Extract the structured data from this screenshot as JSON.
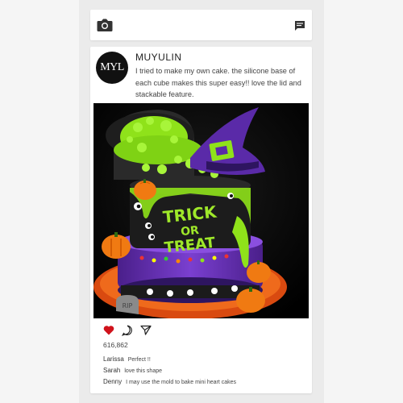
{
  "header": {
    "left_icon": "camera-icon",
    "right_icon": "message-icon"
  },
  "post": {
    "avatar_text": "MYL",
    "username": "MUYULIN",
    "caption": "I tried to make my own cake. the silicone base of each cube makes this super easy!! love the lid and stackable feature.",
    "image": {
      "cake_text_line1": "TRICK",
      "cake_text_line2": "OR",
      "cake_text_line3": "TREAT",
      "tombstone_text": "RIP"
    },
    "actions": {
      "like_icon": "heart-icon",
      "comment_icon": "comment-icon",
      "share_icon": "share-icon"
    },
    "likes": "616,862",
    "comments": [
      {
        "user": "Larissa",
        "text": "Perfect !!"
      },
      {
        "user": "Sarah",
        "text": "love this shape"
      },
      {
        "user": "Denny",
        "text": "I may use the mold to bake mini heart cakes"
      }
    ]
  },
  "colors": {
    "page_bg": "#f5f5f5",
    "phone_bg": "#ebebeb",
    "card_bg": "#ffffff",
    "heart": "#d0121b",
    "slime_green": "#8fe21a",
    "witch_purple": "#6a2fb8",
    "cake_black": "#1c1c1c",
    "pumpkin_orange": "#f07a12"
  }
}
